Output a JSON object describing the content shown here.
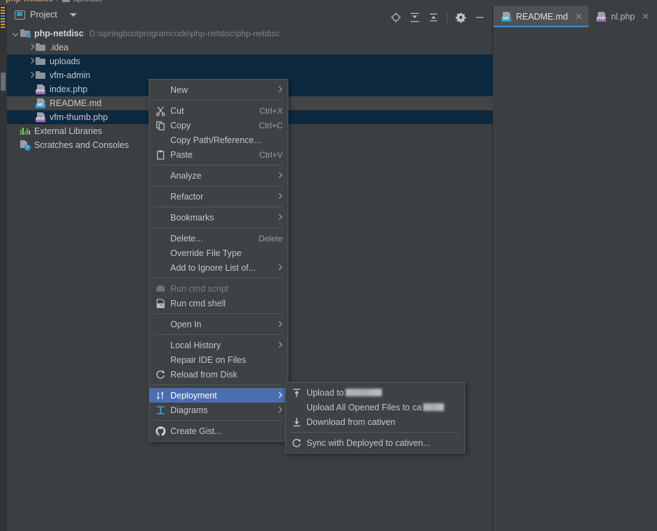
{
  "window": {
    "background": "#3c3f41",
    "selection_navy": "#0d293f",
    "selection_gray": "#414547",
    "menu_highlight": "#4b6eaf",
    "accent_blue": "#3592c4"
  },
  "breadcrumb": {
    "items": [
      {
        "label": "php-netdisc",
        "icon": "folder-icon",
        "bold": true
      },
      {
        "label": "uploads",
        "icon": "folder-icon",
        "bold": false
      }
    ],
    "separator": "/"
  },
  "tool_window": {
    "title": "Project",
    "icon": "project-window-icon",
    "dropdown_icon": "chevron-down-icon",
    "actions": [
      {
        "name": "select-opened-file-icon",
        "tooltip": "Select Opened File"
      },
      {
        "name": "expand-all-icon",
        "tooltip": "Expand All"
      },
      {
        "name": "collapse-all-icon",
        "tooltip": "Collapse All"
      },
      {
        "name": "settings-gear-icon",
        "tooltip": "Options"
      },
      {
        "name": "hide-icon",
        "tooltip": "Hide"
      }
    ]
  },
  "tree": {
    "rows": [
      {
        "indent": 0,
        "arrow": "down",
        "icon": "module-folder-icon",
        "name": "php-netdisc",
        "bold": true,
        "path": "D:\\springbootprogramcode\\php-netdisc\\php-netdisc",
        "selected": "none"
      },
      {
        "indent": 1,
        "arrow": "right",
        "icon": "folder-icon",
        "name": ".idea",
        "bold": false,
        "path": "",
        "selected": "none"
      },
      {
        "indent": 1,
        "arrow": "right",
        "icon": "folder-icon",
        "name": "uploads",
        "bold": false,
        "path": "",
        "selected": "navy"
      },
      {
        "indent": 1,
        "arrow": "right",
        "icon": "folder-icon",
        "name": "vfm-admin",
        "bold": false,
        "path": "",
        "selected": "navy"
      },
      {
        "indent": 1,
        "arrow": "none",
        "icon": "php-file-icon",
        "name": "index.php",
        "bold": false,
        "path": "",
        "selected": "navy"
      },
      {
        "indent": 1,
        "arrow": "none",
        "icon": "md-file-icon",
        "name": "README.md",
        "bold": false,
        "path": "",
        "selected": "gray"
      },
      {
        "indent": 1,
        "arrow": "none",
        "icon": "php-file-icon",
        "name": "vfm-thumb.php",
        "bold": false,
        "path": "",
        "selected": "navy"
      },
      {
        "indent": 0,
        "arrow": "none",
        "icon": "external-libraries-icon",
        "name": "External Libraries",
        "bold": false,
        "path": "",
        "selected": "none"
      },
      {
        "indent": 0,
        "arrow": "none",
        "icon": "scratches-icon",
        "name": "Scratches and Consoles",
        "bold": false,
        "path": "",
        "selected": "none"
      }
    ]
  },
  "editor_tabs": [
    {
      "label": "README.md",
      "icon": "md-file-icon",
      "active": true,
      "close_icon": "close-icon"
    },
    {
      "label": "nl.php",
      "icon": "php-file-icon",
      "active": false,
      "close_icon": "close-icon"
    },
    {
      "label": "",
      "icon": "php-file-icon",
      "active": false,
      "close_icon": ""
    }
  ],
  "context_menu": {
    "items": [
      {
        "type": "item",
        "label": "New",
        "mnemonic": "N",
        "icon": "",
        "accel": "",
        "submenu": true,
        "disabled": false,
        "highlighted": false
      },
      {
        "type": "separator"
      },
      {
        "type": "item",
        "label": "Cut",
        "mnemonic": "C",
        "icon": "cut-icon",
        "accel": "Ctrl+X",
        "submenu": false,
        "disabled": false,
        "highlighted": false
      },
      {
        "type": "item",
        "label": "Copy",
        "mnemonic": "C",
        "icon": "copy-icon",
        "accel": "Ctrl+C",
        "submenu": false,
        "disabled": false,
        "highlighted": false
      },
      {
        "type": "item",
        "label": "Copy Path/Reference...",
        "mnemonic": "",
        "icon": "",
        "accel": "",
        "submenu": false,
        "disabled": false,
        "highlighted": false
      },
      {
        "type": "item",
        "label": "Paste",
        "mnemonic": "P",
        "icon": "paste-icon",
        "accel": "Ctrl+V",
        "submenu": false,
        "disabled": false,
        "highlighted": false
      },
      {
        "type": "separator"
      },
      {
        "type": "item",
        "label": "Analyze",
        "mnemonic": "z",
        "icon": "",
        "accel": "",
        "submenu": true,
        "disabled": false,
        "highlighted": false
      },
      {
        "type": "separator"
      },
      {
        "type": "item",
        "label": "Refactor",
        "mnemonic": "R",
        "icon": "",
        "accel": "",
        "submenu": true,
        "disabled": false,
        "highlighted": false
      },
      {
        "type": "separator"
      },
      {
        "type": "item",
        "label": "Bookmarks",
        "mnemonic": "",
        "icon": "",
        "accel": "",
        "submenu": true,
        "disabled": false,
        "highlighted": false
      },
      {
        "type": "separator"
      },
      {
        "type": "item",
        "label": "Delete...",
        "mnemonic": "D",
        "icon": "",
        "accel": "Delete",
        "submenu": false,
        "disabled": false,
        "highlighted": false
      },
      {
        "type": "item",
        "label": "Override File Type",
        "mnemonic": "",
        "icon": "",
        "accel": "",
        "submenu": false,
        "disabled": false,
        "highlighted": false
      },
      {
        "type": "item",
        "label": "Add to Ignore List of...",
        "mnemonic": "",
        "icon": "",
        "accel": "",
        "submenu": true,
        "disabled": false,
        "highlighted": false
      },
      {
        "type": "separator"
      },
      {
        "type": "item",
        "label": "Run cmd script",
        "mnemonic": "",
        "icon": "run-cmd-script-icon",
        "accel": "",
        "submenu": false,
        "disabled": true,
        "highlighted": false
      },
      {
        "type": "item",
        "label": "Run cmd shell",
        "mnemonic": "",
        "icon": "run-cmd-shell-icon",
        "accel": "",
        "submenu": false,
        "disabled": false,
        "highlighted": false
      },
      {
        "type": "separator"
      },
      {
        "type": "item",
        "label": "Open In",
        "mnemonic": "",
        "icon": "",
        "accel": "",
        "submenu": true,
        "disabled": false,
        "highlighted": false
      },
      {
        "type": "separator"
      },
      {
        "type": "item",
        "label": "Local History",
        "mnemonic": "H",
        "icon": "",
        "accel": "",
        "submenu": true,
        "disabled": false,
        "highlighted": false
      },
      {
        "type": "item",
        "label": "Repair IDE on Files",
        "mnemonic": "",
        "icon": "",
        "accel": "",
        "submenu": false,
        "disabled": false,
        "highlighted": false
      },
      {
        "type": "item",
        "label": "Reload from Disk",
        "mnemonic": "",
        "icon": "reload-icon",
        "accel": "",
        "submenu": false,
        "disabled": false,
        "highlighted": false
      },
      {
        "type": "separator"
      },
      {
        "type": "item",
        "label": "Deployment",
        "mnemonic": "",
        "icon": "deployment-icon",
        "accel": "",
        "submenu": true,
        "disabled": false,
        "highlighted": true
      },
      {
        "type": "item",
        "label": "Diagrams",
        "mnemonic": "",
        "icon": "diagrams-icon",
        "accel": "",
        "submenu": true,
        "disabled": false,
        "highlighted": false
      },
      {
        "type": "separator"
      },
      {
        "type": "item",
        "label": "Create Gist...",
        "mnemonic": "",
        "icon": "github-icon",
        "accel": "",
        "submenu": false,
        "disabled": false,
        "highlighted": false
      }
    ]
  },
  "deployment_submenu": {
    "items": [
      {
        "type": "item",
        "label": "Upload to",
        "mnemonic": "U",
        "icon": "upload-icon",
        "redacted_width": 52,
        "redacted": true
      },
      {
        "type": "item",
        "label": "Upload All Opened Files to ca",
        "mnemonic": "",
        "icon": "",
        "redacted_width": 30,
        "redacted": true
      },
      {
        "type": "item",
        "label": "Download from cativen",
        "mnemonic": "D",
        "icon": "download-icon",
        "redacted_width": 0,
        "redacted": false
      },
      {
        "type": "separator"
      },
      {
        "type": "item",
        "label": "Sync with Deployed to cativen...",
        "mnemonic": "S",
        "icon": "sync-icon",
        "redacted_width": 0,
        "redacted": false
      }
    ]
  }
}
